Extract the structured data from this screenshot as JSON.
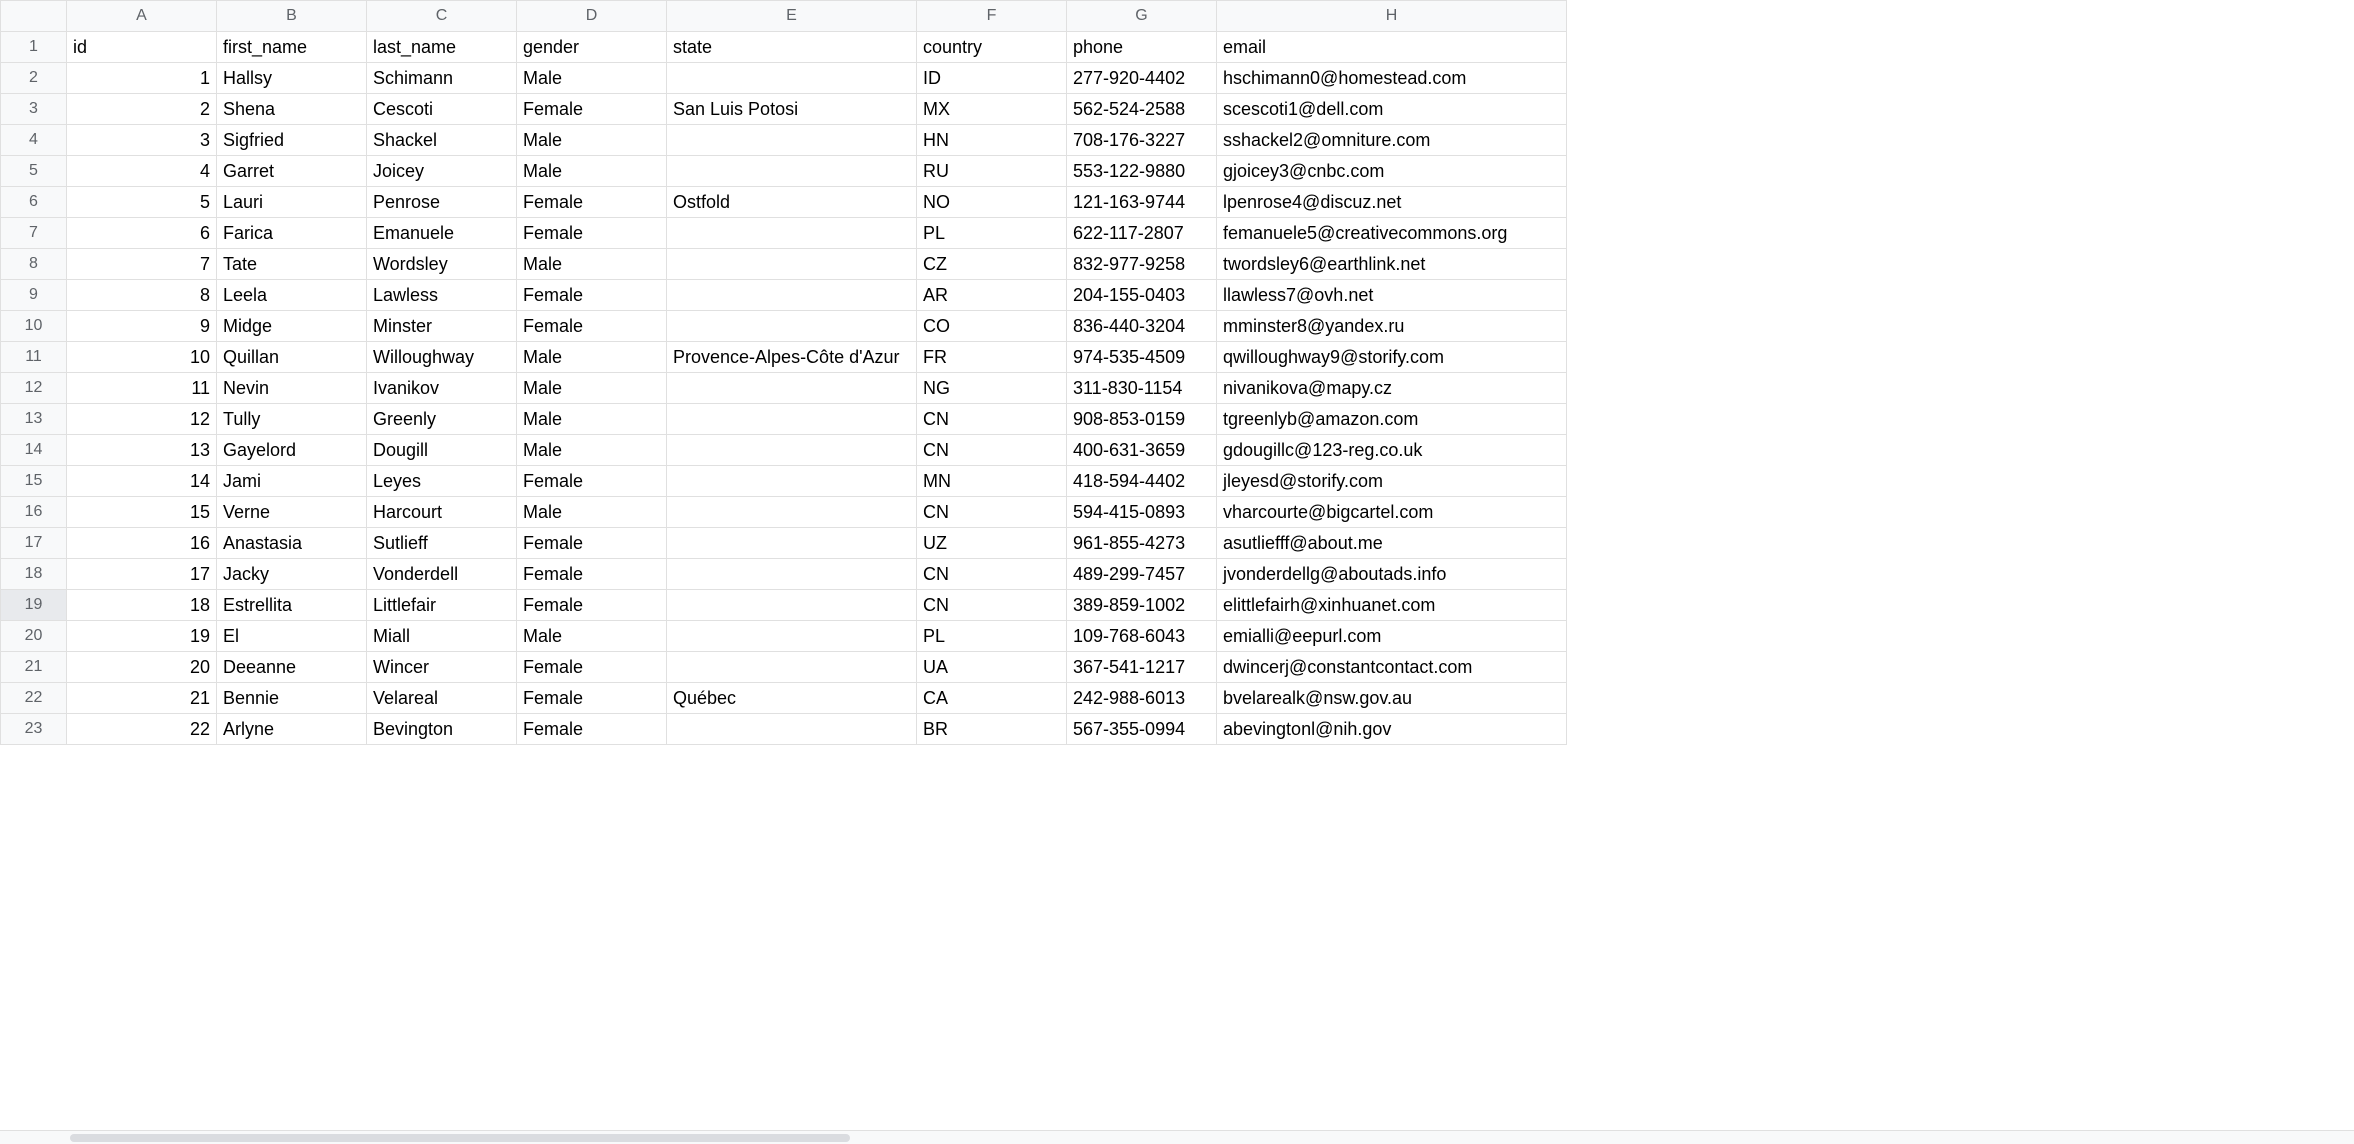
{
  "columns": [
    "A",
    "B",
    "C",
    "D",
    "E",
    "F",
    "G",
    "H"
  ],
  "column_widths": [
    "col-A",
    "col-B",
    "col-C",
    "col-D",
    "col-E",
    "col-F",
    "col-G",
    "col-H"
  ],
  "headers": [
    "id",
    "first_name",
    "last_name",
    "gender",
    "state",
    "country",
    "phone",
    "email"
  ],
  "selected_row_header": 19,
  "rows": [
    {
      "n": 1,
      "cells": [
        "id",
        "first_name",
        "last_name",
        "gender",
        "state",
        "country",
        "phone",
        "email"
      ],
      "is_header": true
    },
    {
      "n": 2,
      "cells": [
        "1",
        "Hallsy",
        "Schimann",
        "Male",
        "",
        "ID",
        "277-920-4402",
        "hschimann0@homestead.com"
      ]
    },
    {
      "n": 3,
      "cells": [
        "2",
        "Shena",
        "Cescoti",
        "Female",
        "San Luis Potosi",
        "MX",
        "562-524-2588",
        "scescoti1@dell.com"
      ]
    },
    {
      "n": 4,
      "cells": [
        "3",
        "Sigfried",
        "Shackel",
        "Male",
        "",
        "HN",
        "708-176-3227",
        "sshackel2@omniture.com"
      ]
    },
    {
      "n": 5,
      "cells": [
        "4",
        "Garret",
        "Joicey",
        "Male",
        "",
        "RU",
        "553-122-9880",
        "gjoicey3@cnbc.com"
      ]
    },
    {
      "n": 6,
      "cells": [
        "5",
        "Lauri",
        "Penrose",
        "Female",
        "Ostfold",
        "NO",
        "121-163-9744",
        "lpenrose4@discuz.net"
      ]
    },
    {
      "n": 7,
      "cells": [
        "6",
        "Farica",
        "Emanuele",
        "Female",
        "",
        "PL",
        "622-117-2807",
        "femanuele5@creativecommons.org"
      ]
    },
    {
      "n": 8,
      "cells": [
        "7",
        "Tate",
        "Wordsley",
        "Male",
        "",
        "CZ",
        "832-977-9258",
        "twordsley6@earthlink.net"
      ]
    },
    {
      "n": 9,
      "cells": [
        "8",
        "Leela",
        "Lawless",
        "Female",
        "",
        "AR",
        "204-155-0403",
        "llawless7@ovh.net"
      ]
    },
    {
      "n": 10,
      "cells": [
        "9",
        "Midge",
        "Minster",
        "Female",
        "",
        "CO",
        "836-440-3204",
        "mminster8@yandex.ru"
      ]
    },
    {
      "n": 11,
      "cells": [
        "10",
        "Quillan",
        "Willoughway",
        "Male",
        "Provence-Alpes-Côte d'Azur",
        "FR",
        "974-535-4509",
        "qwilloughway9@storify.com"
      ]
    },
    {
      "n": 12,
      "cells": [
        "11",
        "Nevin",
        "Ivanikov",
        "Male",
        "",
        "NG",
        "311-830-1154",
        "nivanikova@mapy.cz"
      ]
    },
    {
      "n": 13,
      "cells": [
        "12",
        "Tully",
        "Greenly",
        "Male",
        "",
        "CN",
        "908-853-0159",
        "tgreenlyb@amazon.com"
      ]
    },
    {
      "n": 14,
      "cells": [
        "13",
        "Gayelord",
        "Dougill",
        "Male",
        "",
        "CN",
        "400-631-3659",
        "gdougillc@123-reg.co.uk"
      ]
    },
    {
      "n": 15,
      "cells": [
        "14",
        "Jami",
        "Leyes",
        "Female",
        "",
        "MN",
        "418-594-4402",
        "jleyesd@storify.com"
      ]
    },
    {
      "n": 16,
      "cells": [
        "15",
        "Verne",
        "Harcourt",
        "Male",
        "",
        "CN",
        "594-415-0893",
        "vharcourte@bigcartel.com"
      ]
    },
    {
      "n": 17,
      "cells": [
        "16",
        "Anastasia",
        "Sutlieff",
        "Female",
        "",
        "UZ",
        "961-855-4273",
        "asutliefff@about.me"
      ]
    },
    {
      "n": 18,
      "cells": [
        "17",
        "Jacky",
        "Vonderdell",
        "Female",
        "",
        "CN",
        "489-299-7457",
        "jvonderdellg@aboutads.info"
      ]
    },
    {
      "n": 19,
      "cells": [
        "18",
        "Estrellita",
        "Littlefair",
        "Female",
        "",
        "CN",
        "389-859-1002",
        "elittlefairh@xinhuanet.com"
      ]
    },
    {
      "n": 20,
      "cells": [
        "19",
        "El",
        "Miall",
        "Male",
        "",
        "PL",
        "109-768-6043",
        "emialli@eepurl.com"
      ]
    },
    {
      "n": 21,
      "cells": [
        "20",
        "Deeanne",
        "Wincer",
        "Female",
        "",
        "UA",
        "367-541-1217",
        "dwincerj@constantcontact.com"
      ]
    },
    {
      "n": 22,
      "cells": [
        "21",
        "Bennie",
        "Velareal",
        "Female",
        "Québec",
        "CA",
        "242-988-6013",
        "bvelarealk@nsw.gov.au"
      ]
    },
    {
      "n": 23,
      "cells": [
        "22",
        "Arlyne",
        "Bevington",
        "Female",
        "",
        "BR",
        "567-355-0994",
        "abevingtonl@nih.gov"
      ]
    }
  ]
}
